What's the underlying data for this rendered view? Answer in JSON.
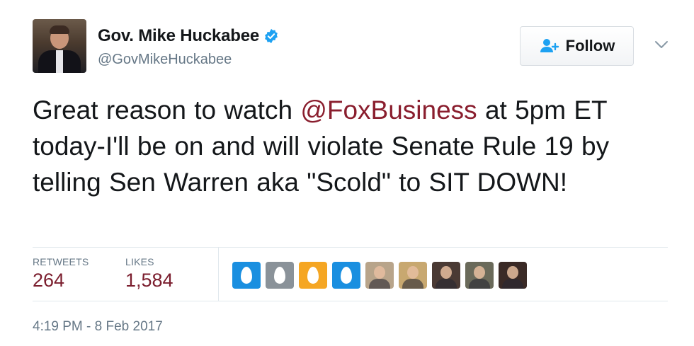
{
  "author": {
    "name": "Gov. Mike Huckabee",
    "handle": "@GovMikeHuckabee",
    "verified": true,
    "verified_icon": "verified-badge-icon",
    "verified_color": "#1da1f2"
  },
  "follow_button": {
    "label": "Follow",
    "icon": "add-user-icon",
    "icon_color": "#1da1f2"
  },
  "menu": {
    "icon": "chevron-down-icon"
  },
  "tweet": {
    "text_before": "Great reason to watch ",
    "mention": "@FoxBusiness",
    "text_after": " at 5pm ET today-I'll be on and will violate Senate Rule 19 by telling Sen Warren aka \"Scold\" to SIT DOWN!",
    "mention_color": "#8a1e2e"
  },
  "stats": {
    "retweets_label": "RETWEETS",
    "retweets_value": "264",
    "likes_label": "LIKES",
    "likes_value": "1,584",
    "value_color": "#7b1e2e"
  },
  "likers": [
    {
      "type": "egg",
      "color": "#1a8fe0"
    },
    {
      "type": "egg",
      "color": "#8a9299"
    },
    {
      "type": "egg",
      "color": "#f5a623"
    },
    {
      "type": "egg",
      "color": "#1a8fe0"
    },
    {
      "type": "photo",
      "color": "#b8a48a"
    },
    {
      "type": "photo",
      "color": "#c8a870"
    },
    {
      "type": "photo",
      "color": "#4a3a34"
    },
    {
      "type": "photo",
      "color": "#6a6a5a"
    },
    {
      "type": "photo",
      "color": "#3a2a26"
    }
  ],
  "timestamp": "4:19 PM - 8 Feb 2017"
}
